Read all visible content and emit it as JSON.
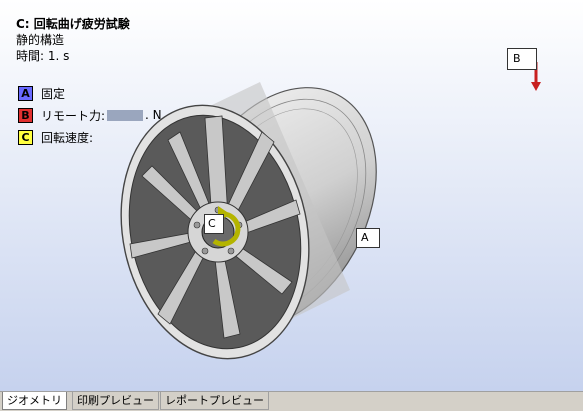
{
  "info": {
    "title": "C: 回転曲げ疲労試験",
    "analysis_type": "静的構造",
    "time": "時間: 1. s"
  },
  "legend": [
    {
      "letter": "A",
      "label": "固定",
      "color": "#6a6aff"
    },
    {
      "letter": "B",
      "label_prefix": "リモート力: ",
      "label_suffix": ". N",
      "color": "#e03030"
    },
    {
      "letter": "C",
      "label": "回転速度:",
      "color": "#ffff40"
    }
  ],
  "tags": {
    "a": "A",
    "b": "B",
    "c": "C"
  },
  "tabs": [
    {
      "label": "ジオメトリ",
      "active": true
    },
    {
      "label": "印刷プレビュー",
      "active": false
    },
    {
      "label": "レポートプレビュー",
      "active": false
    }
  ],
  "colors": {
    "force_arrow": "#c82020",
    "rotation_arrow": "#b4b400"
  }
}
